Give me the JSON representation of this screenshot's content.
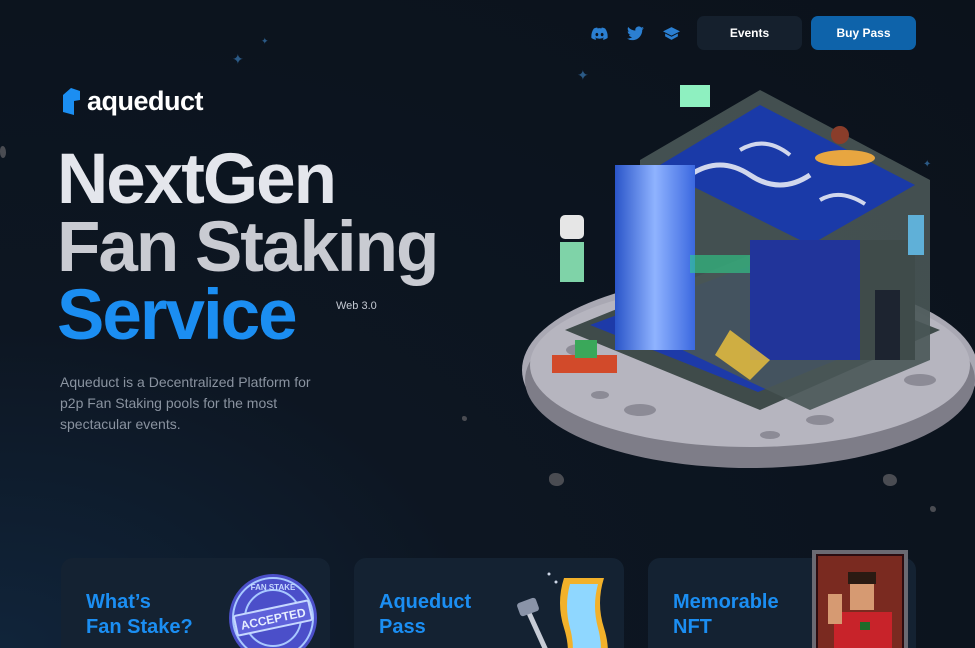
{
  "header": {
    "social": [
      "discord-icon",
      "twitter-icon",
      "gitbook-icon"
    ],
    "events_label": "Events",
    "buy_label": "Buy Pass"
  },
  "logo": {
    "text": "aqueduct"
  },
  "hero": {
    "line1": "NextGen",
    "line2": "Fan Staking",
    "line3": "Service",
    "badge": "Web 3.0",
    "description": "Aqueduct is a Decentralized Platform for p2p Fan Staking pools for the most spectacular events."
  },
  "cards": [
    {
      "title_line1": "What’s",
      "title_line2": "Fan Stake?",
      "stamp_label": "ACCEPTED",
      "stamp_ring": "FAN STAKE"
    },
    {
      "title_line1": "Aqueduct",
      "title_line2": "Pass"
    },
    {
      "title_line1": "Memorable",
      "title_line2": "NFT"
    }
  ],
  "colors": {
    "accent": "#1b8ef2",
    "button_primary": "#0e63aa",
    "button_secondary": "#15202d",
    "background": "#0b121b"
  }
}
